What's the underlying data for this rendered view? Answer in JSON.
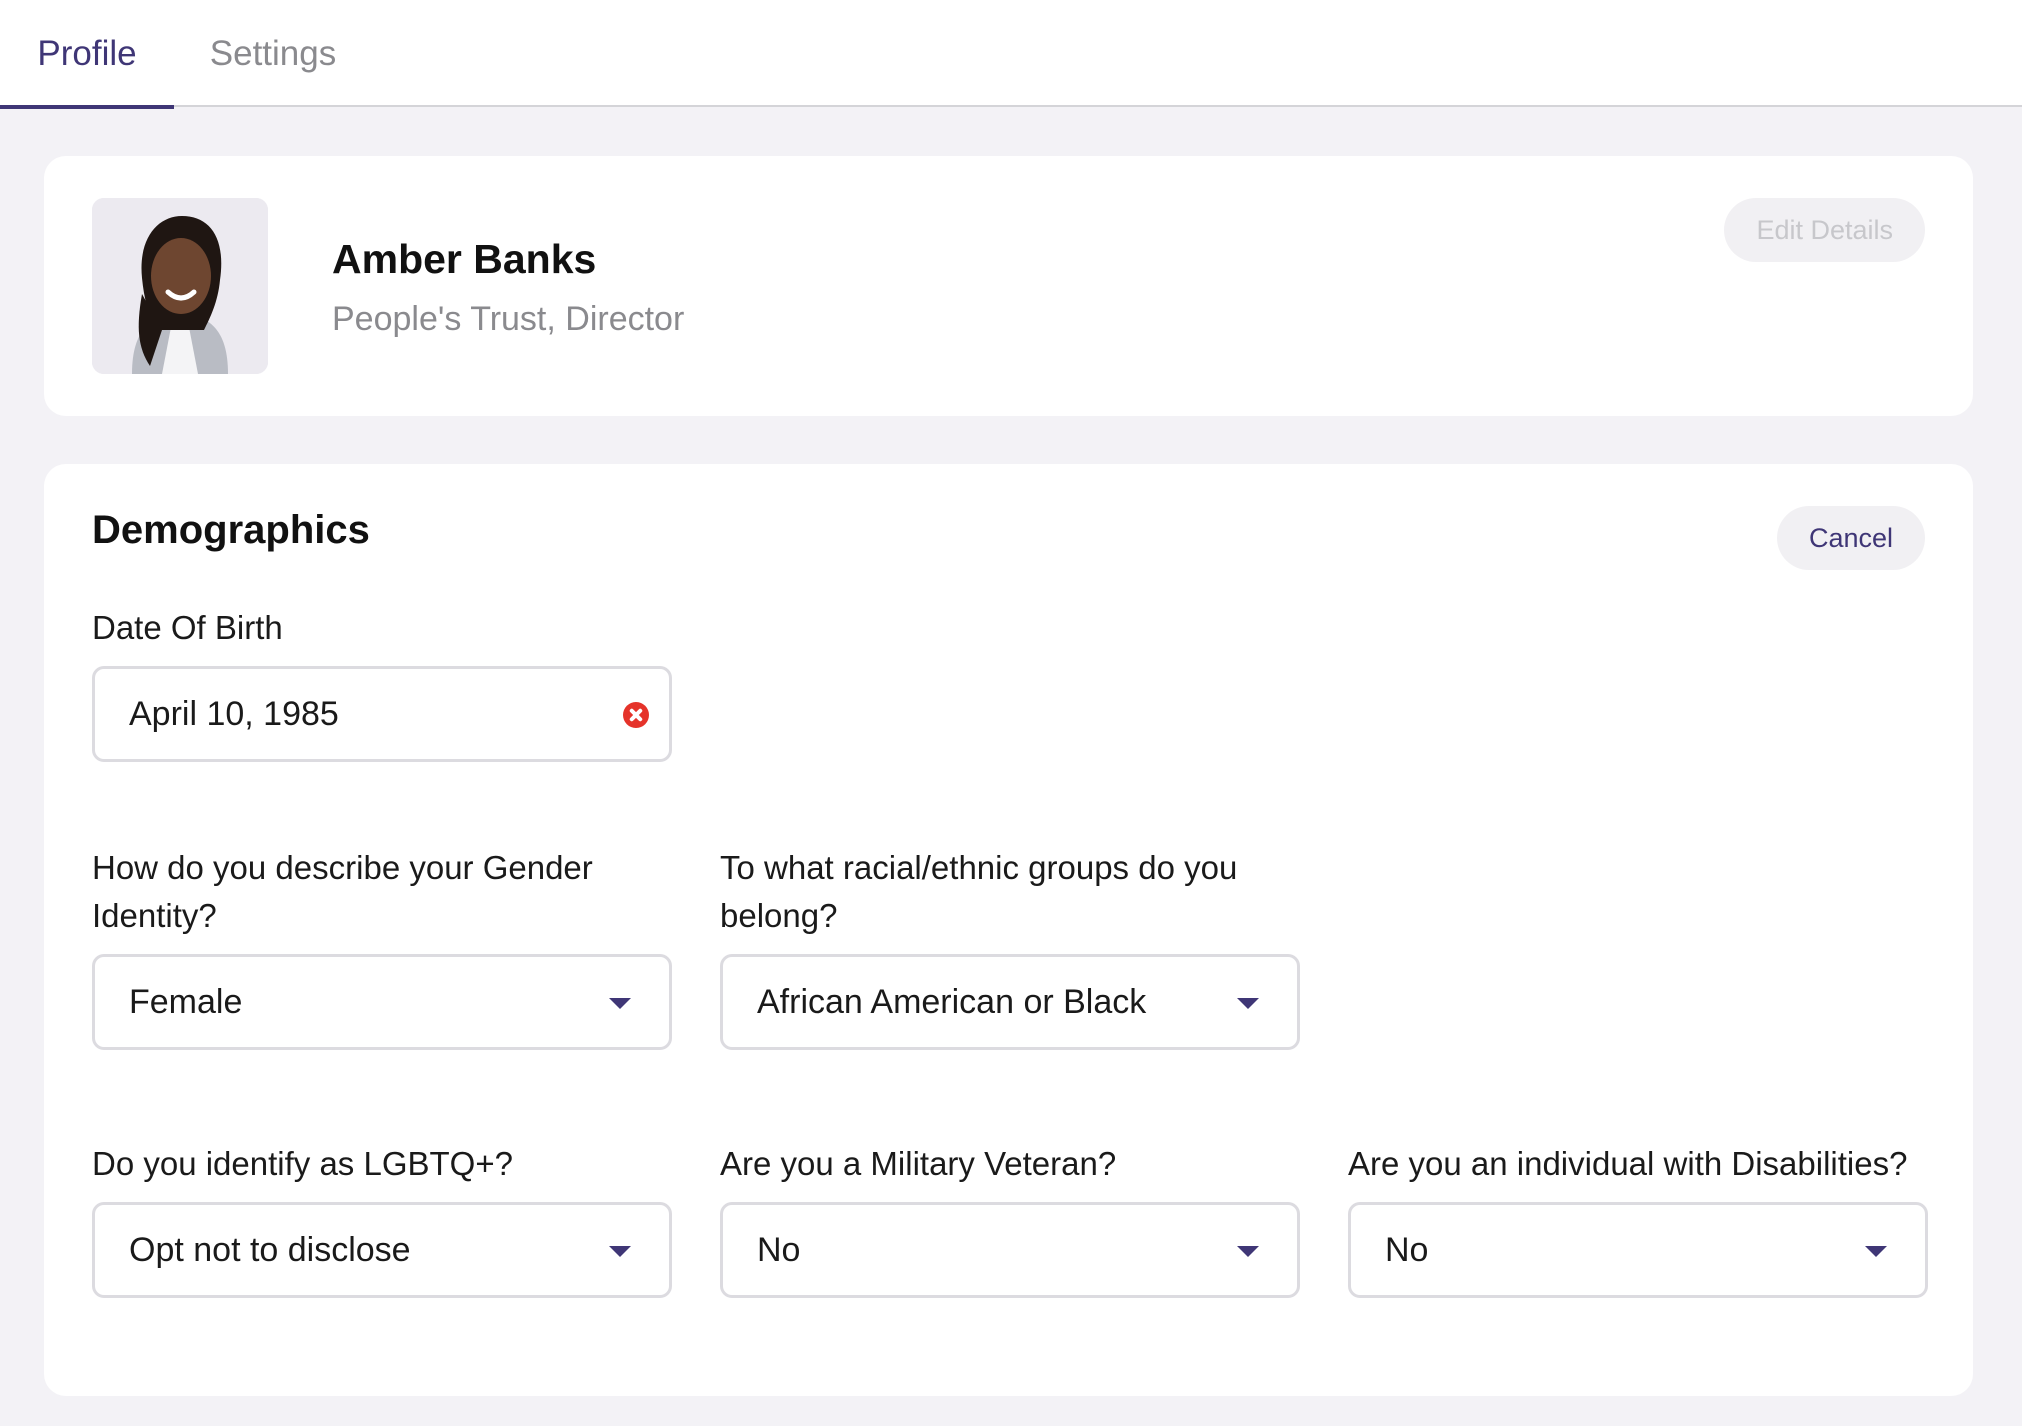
{
  "tabs": [
    {
      "label": "Profile",
      "active": true
    },
    {
      "label": "Settings",
      "active": false
    }
  ],
  "profile": {
    "name": "Amber Banks",
    "org_title": "People's Trust, Director",
    "edit_label": "Edit Details",
    "avatar_icon": "profile-photo"
  },
  "demographics": {
    "title": "Demographics",
    "cancel_label": "Cancel",
    "dob": {
      "label": "Date Of Birth",
      "value": "April 10, 1985"
    },
    "gender": {
      "label": "How do you describe your Gender Identity?",
      "value": "Female"
    },
    "race": {
      "label": "To what racial/ethnic groups do you belong?",
      "value": "African American or Black"
    },
    "lgbtq": {
      "label": "Do you identify as LGBTQ+?",
      "value": "Opt not to disclose"
    },
    "veteran": {
      "label": "Are you a Military Veteran?",
      "value": "No"
    },
    "disability": {
      "label": "Are you an individual with Disabilities?",
      "value": "No"
    }
  },
  "colors": {
    "accent": "#3f3676",
    "muted_text": "#8a8a8e",
    "background": "#f3f2f6",
    "clear_icon": "#e5332a"
  }
}
